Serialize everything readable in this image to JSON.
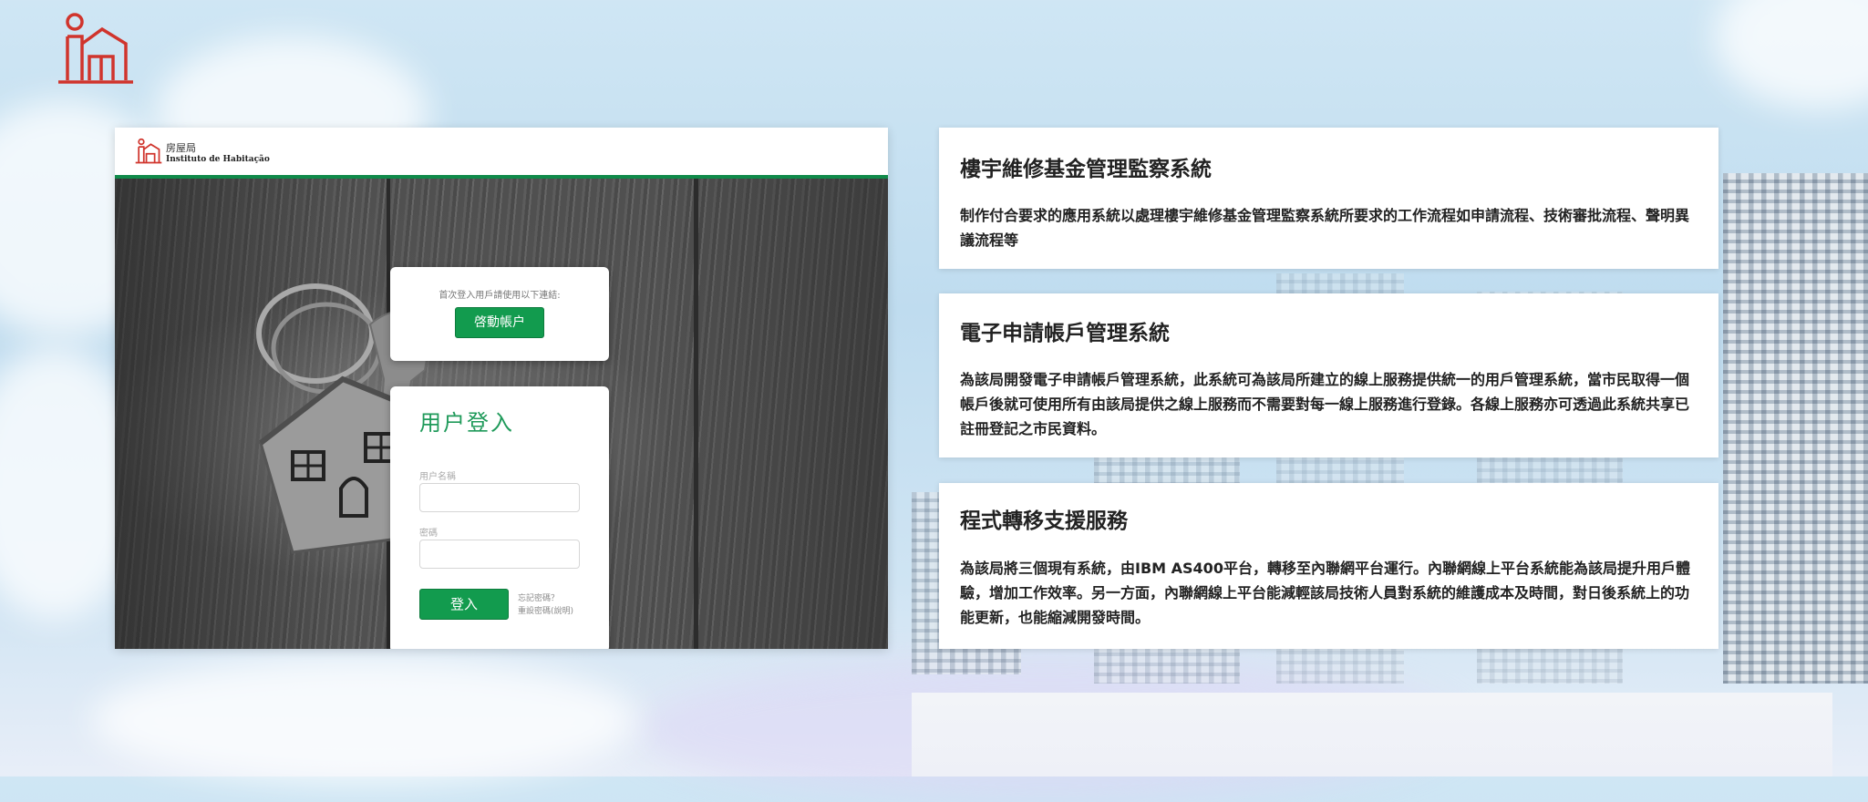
{
  "header": {
    "logo_icon": "housing-bureau-logo-icon"
  },
  "login_panel": {
    "org_name_zh": "房屋局",
    "org_name_pt": "Instituto de Habitação",
    "first_login_hint": "首次登入用戶請使用以下連結:",
    "activate_button": "啓動帳户",
    "login_title": "用户登入",
    "username_label": "用户名稱",
    "username_value": "",
    "password_label": "密碼",
    "password_value": "",
    "login_button": "登入",
    "forgot_password": "忘記密碼？",
    "reset_password": "重設密碼(說明)"
  },
  "info_cards": [
    {
      "title": "樓宇維修基金管理監察系統",
      "body": "制作付合要求的應用系統以處理樓宇維修基金管理監察系統所要求的工作流程如申請流程、技術審批流程、聲明異議流程等"
    },
    {
      "title": "電子申請帳戶管理系統",
      "body": "為該局開發電子申請帳戶管理系統，此系統可為該局所建立的線上服務提供統一的用戶管理系統，當市民取得一個帳戶後就可使用所有由該局提供之線上服務而不需要對每一線上服務進行登錄。各線上服務亦可透過此系統共享已註冊登記之市民資料。"
    },
    {
      "title": "程式轉移支援服務",
      "body": "為該局將三個現有系統，由IBM AS400平台，轉移至內聯網平台運行。內聯網線上平台系統能為該局提升用戶體驗，增加工作效率。另一方面，內聯網線上平台能減輕該局技術人員對系統的維護成本及時間，對日後系統上的功能更新，也能縮減開發時間。"
    }
  ],
  "colors": {
    "brand_red": "#d0342c",
    "brand_green": "#129b4e"
  }
}
